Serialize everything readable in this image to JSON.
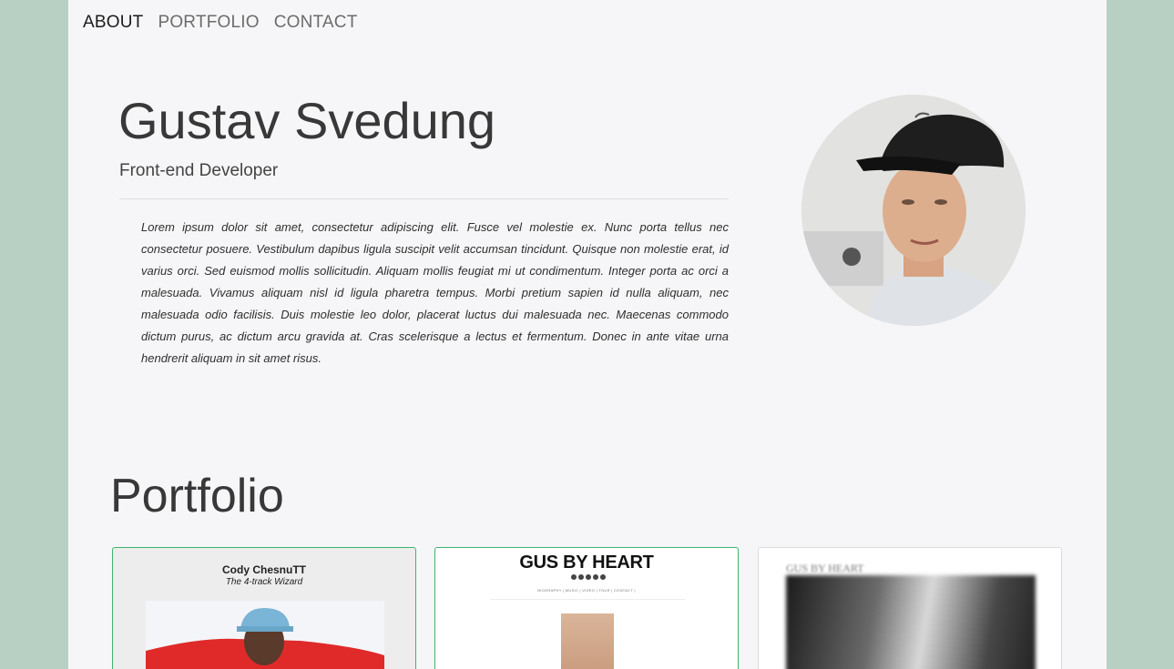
{
  "nav": {
    "items": [
      {
        "label": "ABOUT",
        "active": true
      },
      {
        "label": "PORTFOLIO",
        "active": false
      },
      {
        "label": "CONTACT",
        "active": false
      }
    ]
  },
  "about": {
    "name": "Gustav Svedung",
    "role": "Front-end Developer",
    "bio": "Lorem ipsum dolor sit amet, consectetur adipiscing elit. Fusce vel molestie ex. Nunc porta tellus nec consectetur posuere. Vestibulum dapibus ligula suscipit velit accumsan tincidunt. Quisque non molestie erat, id varius orci. Sed euismod mollis sollicitudin. Aliquam mollis feugiat mi ut condimentum. Integer porta ac orci a malesuada. Vivamus aliquam nisl id ligula pharetra tempus. Morbi pretium sapien id nulla aliquam, nec malesuada odio facilisis. Duis molestie leo dolor, placerat luctus dui malesuada nec. Maecenas commodo dictum purus, ac dictum arcu gravida at. Cras scelerisque a lectus et fermentum. Donec in ante vitae urna hendrerit aliquam in sit amet risus.",
    "avatar_icon": "profile-photo"
  },
  "portfolio": {
    "title": "Portfolio",
    "cards": [
      {
        "title": "Cody ChesnuTT",
        "subtitle": "The 4-track Wizard"
      },
      {
        "title": "GUS BY HEART",
        "nav_text": "BIOGRAPHY | MUSIC | VIDEO | TOUR | CONTACT |"
      },
      {
        "title": "GUS BY HEART"
      }
    ]
  },
  "colors": {
    "background": "#b8d0c3",
    "page": "#f6f6f8",
    "card_highlight": "#3fb46a"
  }
}
